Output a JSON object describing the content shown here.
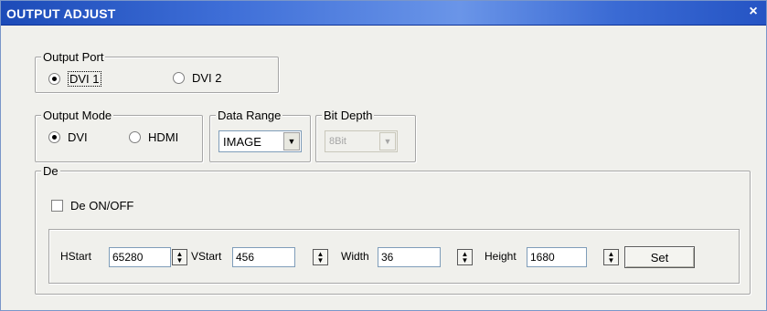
{
  "window": {
    "title": "OUTPUT ADJUST",
    "close_glyph": "×"
  },
  "output_port": {
    "legend": "Output Port",
    "options": [
      {
        "label": "DVI 1",
        "selected": true
      },
      {
        "label": "DVI 2",
        "selected": false
      }
    ]
  },
  "output_mode": {
    "legend": "Output Mode",
    "options": [
      {
        "label": "DVI",
        "selected": true
      },
      {
        "label": "HDMI",
        "selected": false
      }
    ]
  },
  "data_range": {
    "legend": "Data Range",
    "value": "IMAGE"
  },
  "bit_depth": {
    "legend": "Bit Depth",
    "value": "8Bit",
    "disabled": true
  },
  "de": {
    "legend": "De",
    "toggle_label": "De ON/OFF",
    "toggle_checked": false,
    "fields": {
      "hstart": {
        "label": "HStart",
        "value": "65280"
      },
      "vstart": {
        "label": "VStart",
        "value": "456"
      },
      "width": {
        "label": "Width",
        "value": "36"
      },
      "height": {
        "label": "Height",
        "value": "1680"
      }
    },
    "set_label": "Set"
  },
  "icons": {
    "close": "close-icon",
    "dropdown": "chevron-down-icon",
    "spinner": "spin-up-down-icon"
  }
}
